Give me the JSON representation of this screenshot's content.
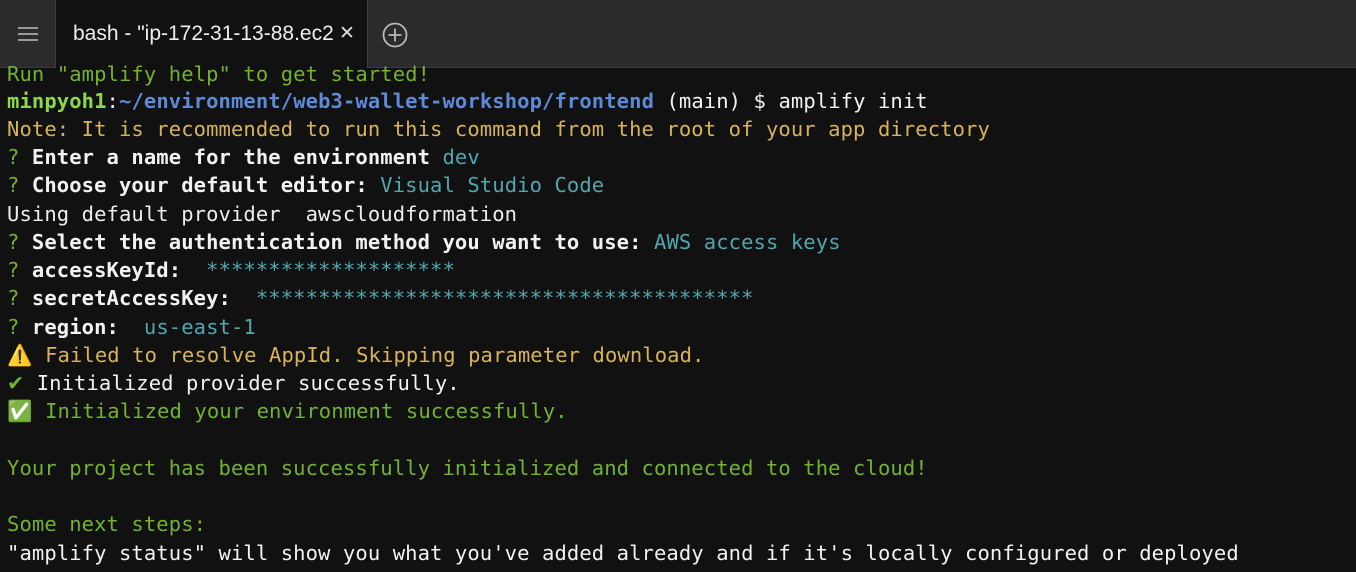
{
  "tabs": [
    {
      "title": "bash - \"ip-172-31-13-88.ec2"
    }
  ],
  "terminal": {
    "partial_line": "Run \"amplify help\" to get started!",
    "prompt": {
      "user": "minpyoh1",
      "sep": ":",
      "path": "~/environment/web3-wallet-workshop/frontend",
      "branch": " (main) $ ",
      "command": "amplify init"
    },
    "note": "Note: It is recommended to run this command from the root of your app directory",
    "q1": {
      "mark": "? ",
      "q": "Enter a name for the environment",
      "a": " dev"
    },
    "q2": {
      "mark": "? ",
      "q": "Choose your default editor:",
      "a": " Visual Studio Code"
    },
    "provider": "Using default provider  awscloudformation",
    "q3": {
      "mark": "? ",
      "q": "Select the authentication method you want to use:",
      "a": " AWS access keys"
    },
    "q4": {
      "mark": "? ",
      "q": "accessKeyId:",
      "a": "  ********************"
    },
    "q5": {
      "mark": "? ",
      "q": "secretAccessKey:",
      "a": "  ****************************************"
    },
    "q6": {
      "mark": "? ",
      "q": "region:",
      "a": "  us-east-1"
    },
    "warn": {
      "icon": "⚠️",
      "text": " Failed to resolve AppId. Skipping parameter download."
    },
    "init_provider": {
      "icon": "✔",
      "text": " Initialized provider successfully."
    },
    "init_env": {
      "icon": "✅",
      "text": " Initialized your environment successfully."
    },
    "success": "Your project has been successfully initialized and connected to the cloud!",
    "next_steps": "Some next steps:",
    "status_line": "\"amplify status\" will show you what you've added already and if it's locally configured or deployed"
  },
  "colors": {
    "background": "#111111",
    "tabbar": "#2b2b2b",
    "green": "#72b230",
    "blue": "#5c8ad6",
    "yellow": "#d7b35a",
    "cyan": "#4fa7b0"
  }
}
